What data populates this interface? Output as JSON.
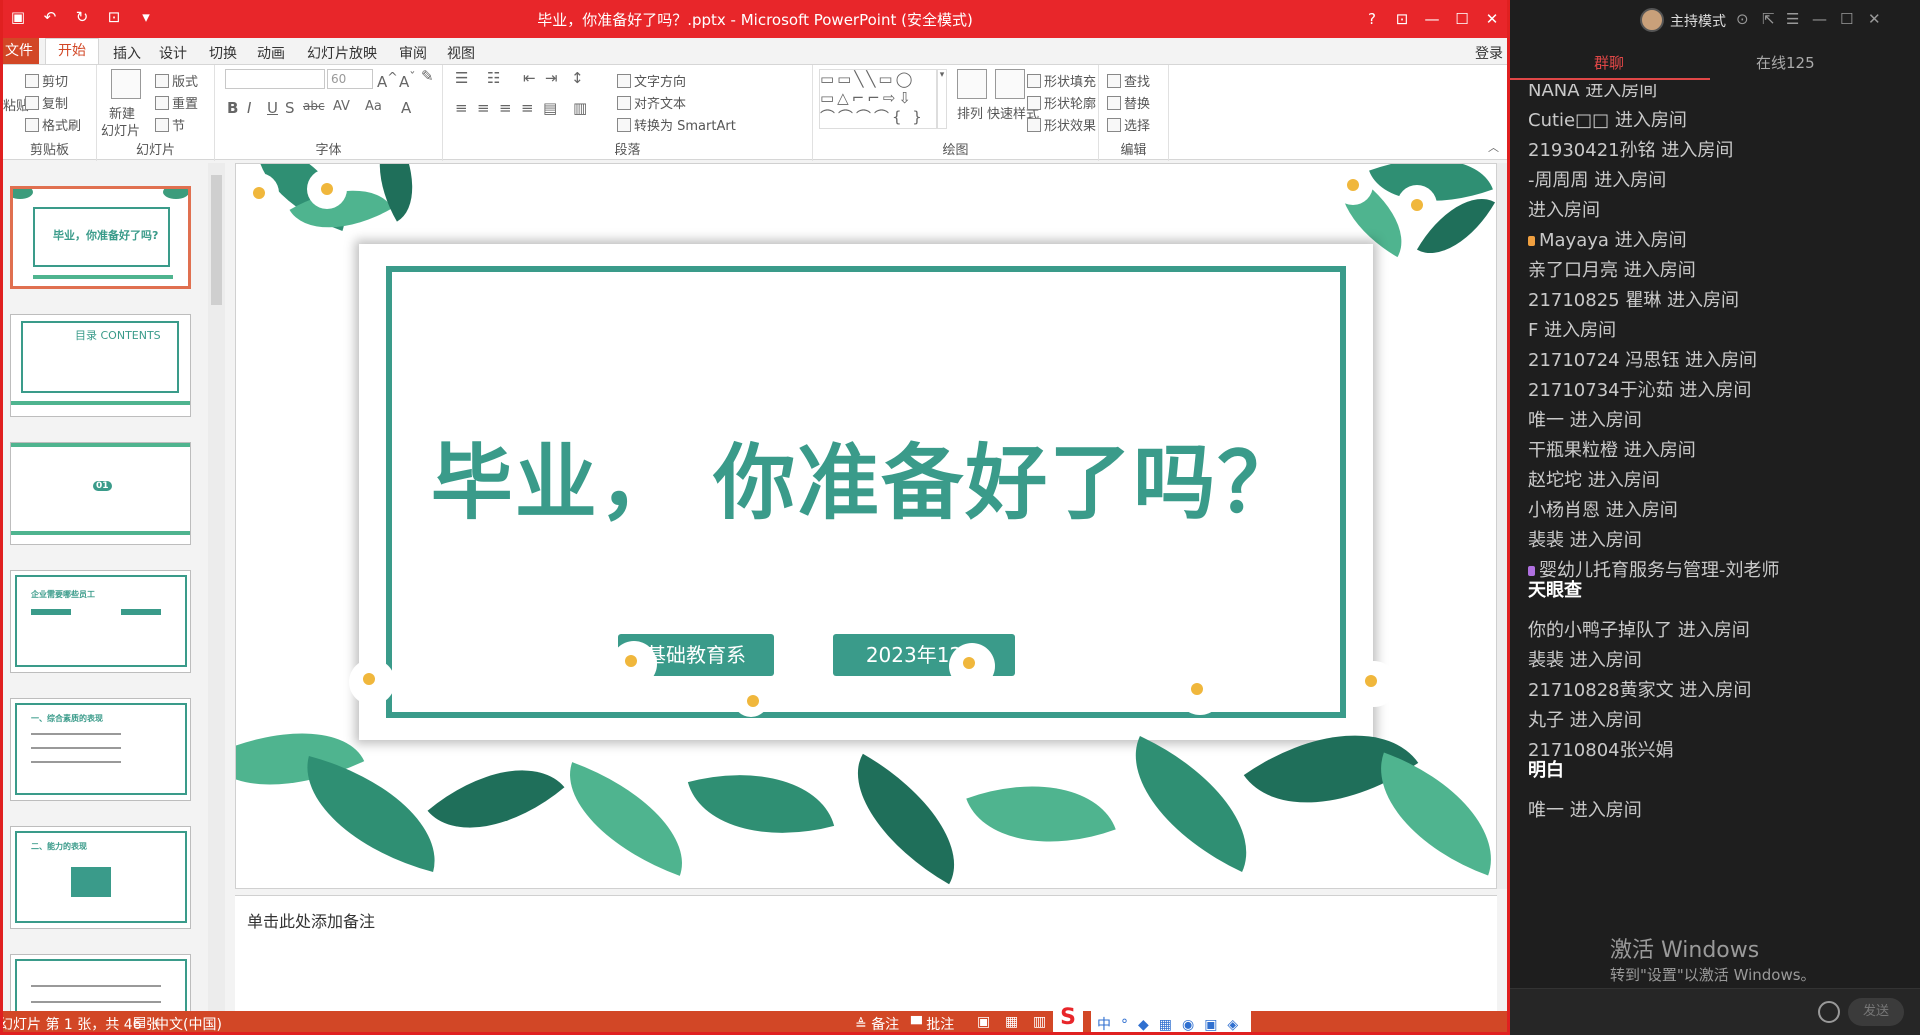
{
  "window": {
    "title": "毕业，你准备好了吗？.pptx - Microsoft PowerPoint (安全模式)",
    "controls": [
      "?",
      "⊡",
      "—",
      "☐",
      "✕"
    ]
  },
  "tabs": {
    "file": "文件",
    "items": [
      "开始",
      "插入",
      "设计",
      "切换",
      "动画",
      "幻灯片放映",
      "审阅",
      "视图"
    ],
    "active": "开始",
    "login": "登录"
  },
  "ribbon": {
    "clipboard": {
      "label": "剪贴板",
      "paste": "粘贴",
      "cut": "剪切",
      "copy": "复制",
      "format_painter": "格式刷"
    },
    "slides": {
      "label": "幻灯片",
      "new_slide_1": "新建",
      "new_slide_2": "幻灯片",
      "layout": "版式",
      "reset": "重置",
      "section": "节"
    },
    "font": {
      "label": "字体",
      "font_size": "60",
      "text_direction": "文字方向",
      "align_text": "对齐文本",
      "smartart": "转换为 SmartArt"
    },
    "paragraph": {
      "label": "段落"
    },
    "drawing": {
      "label": "绘图",
      "arrange": "排列",
      "quick_styles": "快速样式",
      "shape_fill": "形状填充",
      "shape_outline": "形状轮廓",
      "shape_effects": "形状效果"
    },
    "editing": {
      "label": "编辑",
      "find": "查找",
      "replace": "替换",
      "select": "选择"
    }
  },
  "thumbnails": [
    {
      "title": "毕业，你准备好了吗?",
      "selected": true
    },
    {
      "title": "目录 CONTENTS",
      "selected": false
    },
    {
      "title": "01",
      "selected": false
    },
    {
      "title": "企业需要哪些员工",
      "selected": false
    },
    {
      "title": "一、综合素质的表现",
      "selected": false
    },
    {
      "title": "二、能力的表现",
      "selected": false
    },
    {
      "title": "",
      "selected": false
    }
  ],
  "slide": {
    "title": "毕业， 你准备好了吗？",
    "button_left": "基础教育系",
    "button_right": "2023年12月",
    "accent": "#3a9b8a"
  },
  "notes": {
    "placeholder": "单击此处添加备注"
  },
  "status": {
    "slide_info": "幻灯片 第 1 张，共 46 张",
    "language": "中文(中国)",
    "notes_btn": "备注",
    "comments_btn": "批注"
  },
  "chat": {
    "mode_label": "主持模式",
    "tab_group": "群聊",
    "tab_online": "在线125",
    "messages": [
      {
        "text": "NANA 进入房间",
        "bold": false,
        "badge": ""
      },
      {
        "text": "Cutie□□ 进入房间",
        "bold": false,
        "badge": ""
      },
      {
        "text": "21930421孙铭 进入房间",
        "bold": false,
        "badge": ""
      },
      {
        "text": "-周周周 进入房间",
        "bold": false,
        "badge": ""
      },
      {
        "text": "    进入房间",
        "bold": false,
        "badge": ""
      },
      {
        "text": "Mayaya 进入房间",
        "bold": false,
        "badge": "#f0a040"
      },
      {
        "text": "亲了口月亮     进入房间",
        "bold": false,
        "badge": ""
      },
      {
        "text": "21710825 瞿琳 进入房间",
        "bold": false,
        "badge": ""
      },
      {
        "text": "F 进入房间",
        "bold": false,
        "badge": ""
      },
      {
        "text": "21710724 冯思钰 进入房间",
        "bold": false,
        "badge": ""
      },
      {
        "text": "21710734于沁茹 进入房间",
        "bold": false,
        "badge": ""
      },
      {
        "text": "唯一 进入房间",
        "bold": false,
        "badge": ""
      },
      {
        "text": "干瓶果粒橙 进入房间",
        "bold": false,
        "badge": ""
      },
      {
        "text": "赵坨坨 进入房间",
        "bold": false,
        "badge": ""
      },
      {
        "text": "小杨肖恩 进入房间",
        "bold": false,
        "badge": ""
      },
      {
        "text": "裴裴 进入房间",
        "bold": false,
        "badge": ""
      },
      {
        "text": "婴幼儿托育服务与管理-刘老师",
        "bold": false,
        "badge": "#b070e0"
      },
      {
        "text": "天眼查",
        "bold": true,
        "badge": ""
      },
      {
        "text": "你的小鸭子掉队了 进入房间",
        "bold": false,
        "badge": ""
      },
      {
        "text": "裴裴 进入房间",
        "bold": false,
        "badge": ""
      },
      {
        "text": "21710828黄家文 进入房间",
        "bold": false,
        "badge": ""
      },
      {
        "text": "丸子     进入房间",
        "bold": false,
        "badge": ""
      },
      {
        "text": "21710804张兴娟",
        "bold": false,
        "badge": ""
      },
      {
        "text": "明白",
        "bold": true,
        "badge": ""
      },
      {
        "text": "唯一 进入房间",
        "bold": false,
        "badge": ""
      }
    ],
    "watermark_title": "激活 Windows",
    "watermark_sub": "转到\"设置\"以激活 Windows。",
    "send": "发送"
  }
}
